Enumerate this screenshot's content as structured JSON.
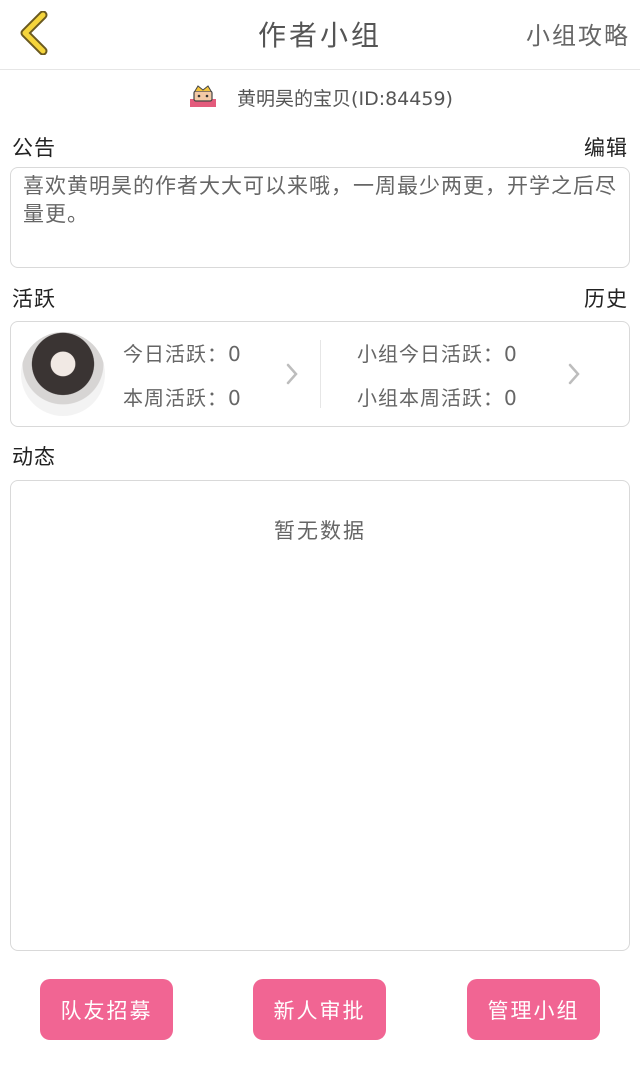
{
  "header": {
    "title": "作者小组",
    "right_link": "小组攻略"
  },
  "leader": {
    "name": "黄明昊的宝贝(ID:84459)",
    "icon": "crown-badge-icon"
  },
  "notice": {
    "label": "公告",
    "edit_link": "编辑",
    "text": "喜欢黄明昊的作者大大可以来哦，一周最少两更，开学之后尽量更。"
  },
  "activity": {
    "label": "活跃",
    "history_link": "历史",
    "personal": {
      "today": "今日活跃：0",
      "week": "本周活跃：0"
    },
    "group": {
      "today": "小组今日活跃：0",
      "week": "小组本周活跃：0"
    }
  },
  "feed": {
    "label": "动态",
    "empty": "暂无数据"
  },
  "actions": {
    "recruit": "队友招募",
    "approve": "新人审批",
    "manage": "管理小组"
  },
  "colors": {
    "accent": "#f16593",
    "back_icon": "#f5d53c"
  }
}
